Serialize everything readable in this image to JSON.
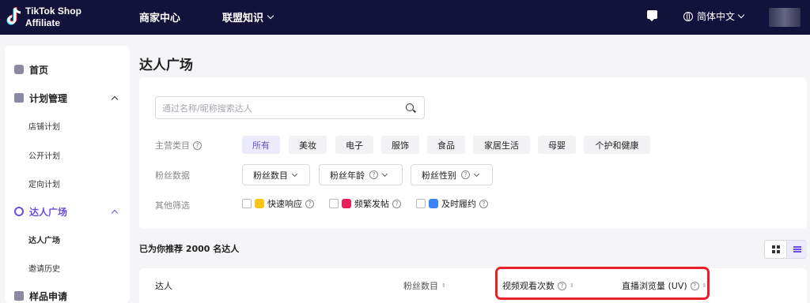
{
  "topbar": {
    "logo_line1": "TikTok Shop",
    "logo_line2": "Affiliate",
    "nav": [
      "商家中心",
      "联盟知识"
    ],
    "language": "简体中文"
  },
  "sidebar": {
    "items": [
      {
        "label": "首页",
        "icon": "home-icon"
      },
      {
        "label": "计划管理",
        "icon": "plan-icon",
        "sub": [
          "店铺计划",
          "公开计划",
          "定向计划"
        ]
      },
      {
        "label": "达人广场",
        "icon": "creator-icon",
        "sub": [
          "达人广场",
          "邀请历史"
        ]
      },
      {
        "label": "样品申请",
        "icon": "sample-icon"
      }
    ]
  },
  "main": {
    "title": "达人广场",
    "search_placeholder": "通过名称/昵称搜索达人",
    "filters": {
      "category_label": "主营类目",
      "categories": [
        "所有",
        "美妆",
        "电子",
        "服饰",
        "食品",
        "家居生活",
        "母婴",
        "个护和健康"
      ],
      "fans_label": "粉丝数据",
      "fans_dropdowns": [
        "粉丝数目",
        "粉丝年龄",
        "粉丝性别"
      ],
      "other_label": "其他筛选",
      "other_options": [
        "快速响应",
        "频繁发帖",
        "及时履约"
      ]
    },
    "summary": "已为你推荐 2000 名达人",
    "table_headers": [
      "达人",
      "粉丝数目",
      "视频观看次数",
      "直播浏览量 (UV)"
    ]
  },
  "colors": {
    "topbar": "#12123a",
    "accent": "#6c4ce0",
    "highlight": "#e8202a"
  }
}
